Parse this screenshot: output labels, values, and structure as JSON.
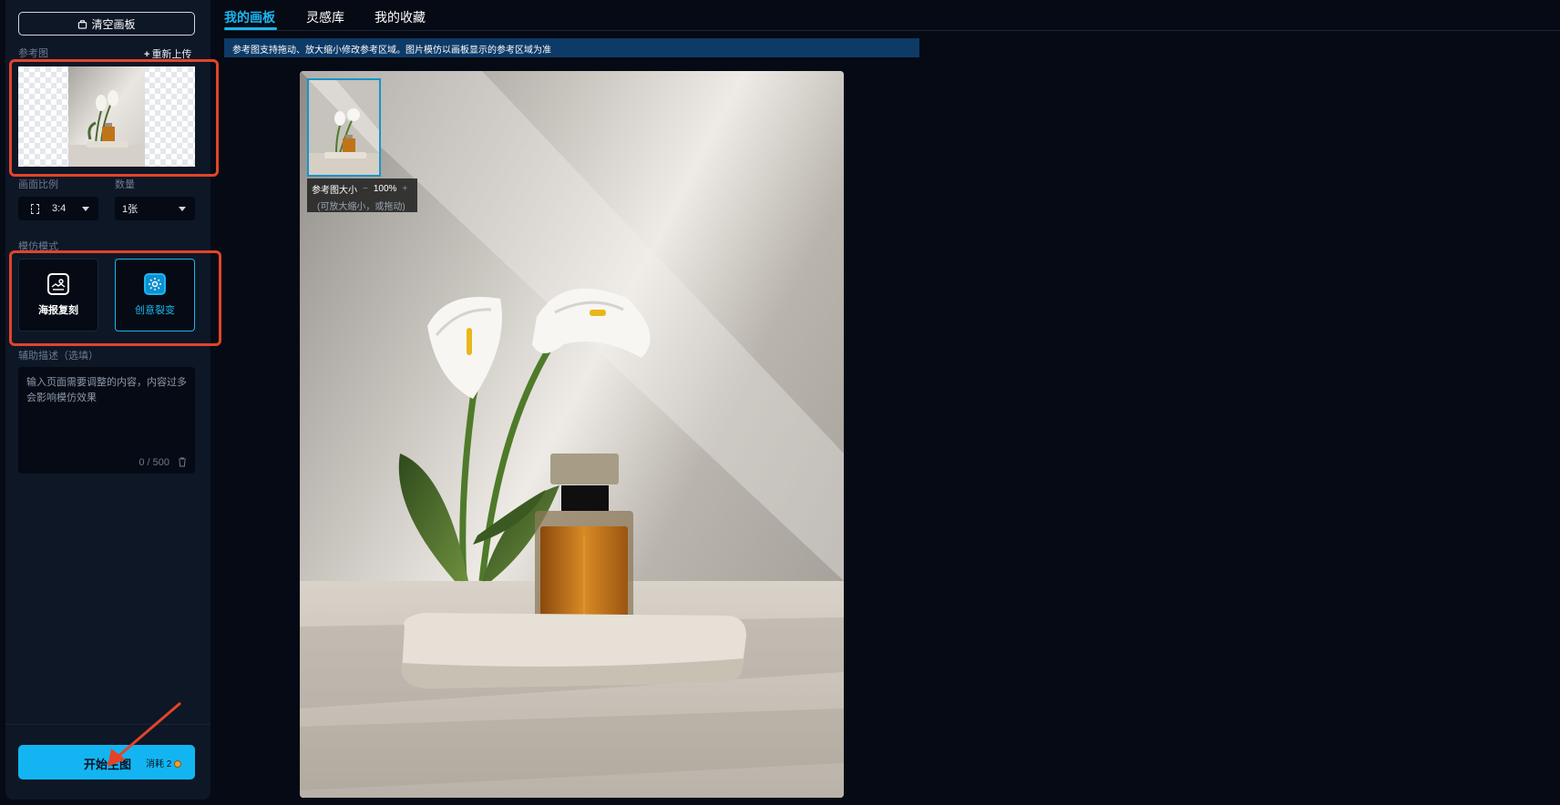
{
  "sidebar": {
    "clear_button": "清空画板",
    "reference_label": "参考图",
    "reupload_plus": "+",
    "reupload_label": "重新上传",
    "ratio_label": "画面比例",
    "quantity_label": "数量",
    "ratio_value": "3:4",
    "quantity_value": "1张",
    "mode_label": "模仿模式",
    "modes": [
      {
        "label": "海报复刻",
        "icon": "image-icon",
        "active": false
      },
      {
        "label": "创意裂变",
        "icon": "gear-icon",
        "active": true
      }
    ],
    "desc_label": "辅助描述（选填）",
    "desc_placeholder": "输入页面需要调整的内容，内容过多会影响模仿效果",
    "char_count": "0 / 500",
    "start_button": "开始生图",
    "cost_label": "消耗",
    "cost_value": "2"
  },
  "tabs": [
    {
      "label": "我的画板",
      "active": true
    },
    {
      "label": "灵感库",
      "active": false
    },
    {
      "label": "我的收藏",
      "active": false
    }
  ],
  "notice": "参考图支持拖动、放大缩小修改参考区域。图片模仿以画板显示的参考区域为准",
  "ref_size": {
    "label": "参考图大小",
    "minus": "−",
    "value": "100%",
    "plus": "+",
    "hint": "(可放大缩小，或拖动)"
  },
  "colors": {
    "accent": "#1bb6f0",
    "highlight": "#e2442a",
    "start_button": "#12b5f2"
  }
}
